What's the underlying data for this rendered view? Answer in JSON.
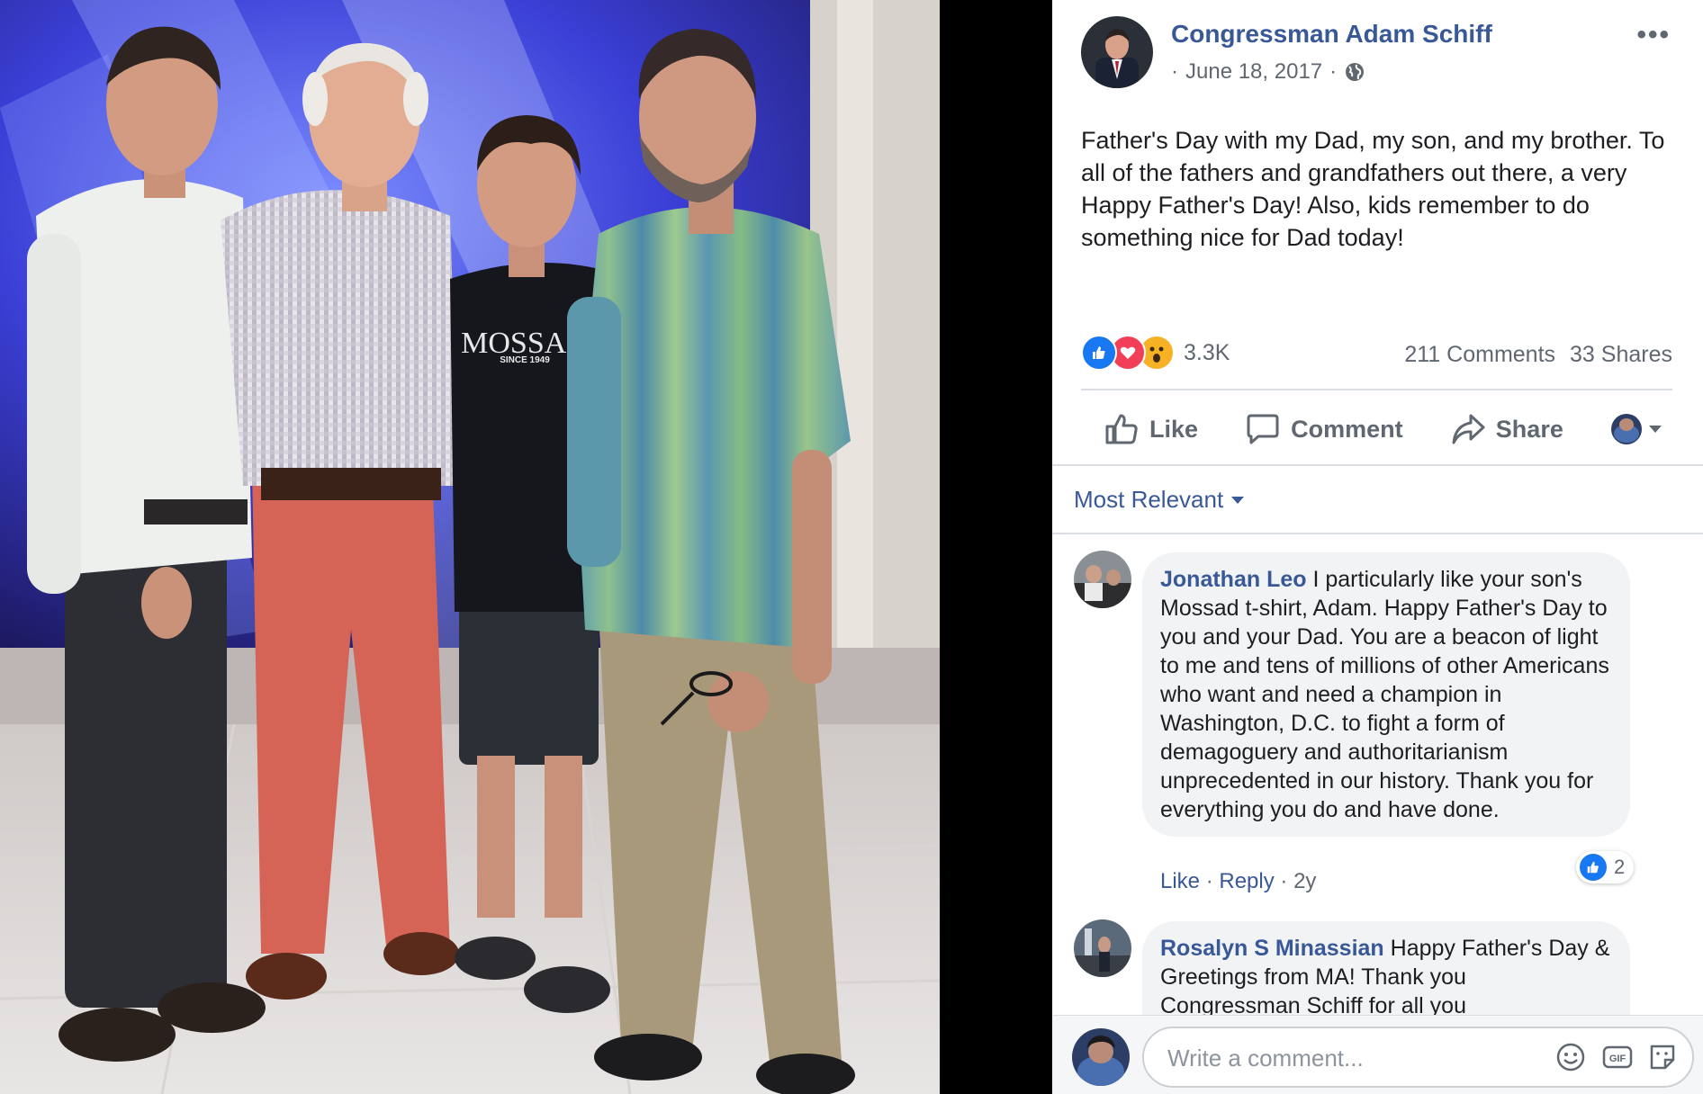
{
  "post": {
    "author": "Congressman Adam Schiff",
    "date": "June 18, 2017",
    "meta_separator": "·",
    "text": "Father's Day with my Dad, my son, and my brother. To all of the fathers and grandfathers out there, a very Happy Father's Day! Also, kids remember to do something nice for Dad today!",
    "reaction_count": "3.3K",
    "comments_count": "211 Comments",
    "shares_count": "33 Shares",
    "photo_shirt_text": "MOSSAD",
    "photo_shirt_subtext": "SINCE 1949"
  },
  "actions": {
    "like": "Like",
    "comment": "Comment",
    "share": "Share"
  },
  "comments_sort": "Most Relevant",
  "comments": [
    {
      "name": "Jonathan Leo",
      "text": "I particularly like your son's Mossad t-shirt, Adam. Happy Father's Day to you and your Dad. You are a beacon of light to me and tens of millions of other Americans who want and need a champion in Washington, D.C. to fight a form of demagoguery and authoritarianism unprecedented in our history. Thank you for everything you do and have done.",
      "like_label": "Like",
      "reply_label": "Reply",
      "age": "2y",
      "like_count": "2"
    },
    {
      "name": "Rosalyn S Minassian",
      "text": "Happy Father's Day & Greetings from MA! Thank you Congressman Schiff for all you"
    }
  ],
  "composer": {
    "placeholder": "Write a comment..."
  },
  "colors": {
    "link": "#385898",
    "secondary_text": "#606770",
    "like_blue": "#1877f2",
    "love_red": "#f33e58",
    "wow_yellow": "#f7b125"
  },
  "icons": [
    "more-options-icon",
    "globe-icon",
    "like-reaction-icon",
    "love-reaction-icon",
    "wow-reaction-icon",
    "thumbs-up-icon",
    "comment-bubble-icon",
    "share-arrow-icon",
    "caret-down-icon",
    "emoji-icon",
    "gif-icon",
    "sticker-icon"
  ]
}
